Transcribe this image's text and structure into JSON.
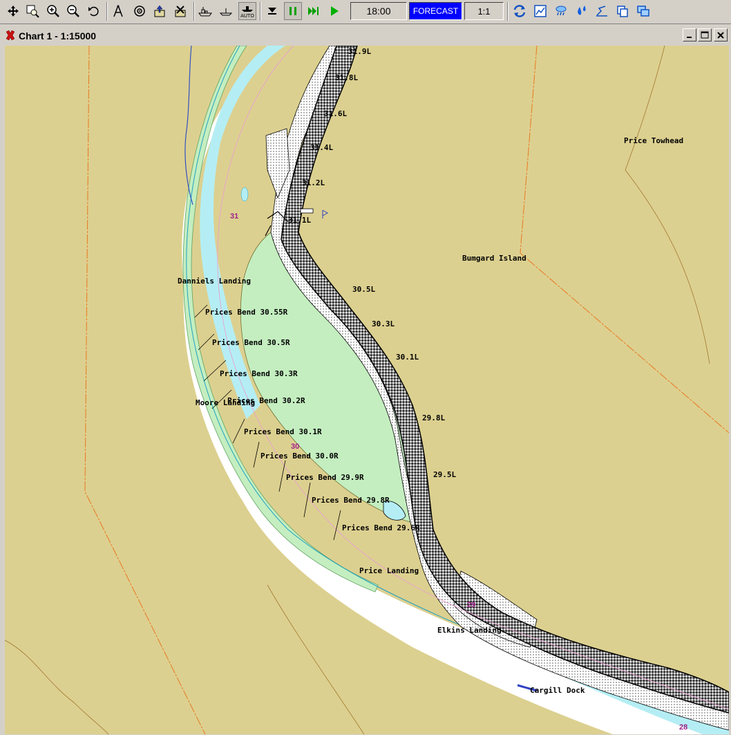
{
  "toolbar": {
    "tools": [
      {
        "name": "pan-icon"
      },
      {
        "name": "zoom-box-icon"
      },
      {
        "name": "zoom-in-icon"
      },
      {
        "name": "zoom-out-icon"
      },
      {
        "name": "undo-view-icon"
      },
      {
        "name": "compass-icon"
      },
      {
        "name": "target-icon"
      },
      {
        "name": "export-icon"
      },
      {
        "name": "delete-icon"
      },
      {
        "name": "vessel-icon"
      },
      {
        "name": "boat-icon"
      },
      {
        "name": "auto-track-icon"
      },
      {
        "name": "stop-icon"
      },
      {
        "name": "pause-icon"
      },
      {
        "name": "fast-forward-icon"
      },
      {
        "name": "play-icon"
      },
      {
        "name": "sync-icon"
      },
      {
        "name": "chart-icon"
      },
      {
        "name": "weather-icon"
      },
      {
        "name": "water-level-icon"
      },
      {
        "name": "route-icon"
      },
      {
        "name": "copy-icon"
      },
      {
        "name": "windows-icon"
      }
    ],
    "auto_label": "AUTO",
    "time": "18:00",
    "forecast_label": "FORECAST",
    "scale_label": "1:1"
  },
  "window": {
    "title": "Chart 1 - 1:15000"
  },
  "map": {
    "mile_labels": [
      {
        "text": "31.9L"
      },
      {
        "text": "31.8L"
      },
      {
        "text": "31.6L"
      },
      {
        "text": "31.4L"
      },
      {
        "text": "31.2L"
      },
      {
        "text": "31.1L"
      },
      {
        "text": "30.5L"
      },
      {
        "text": "30.3L"
      },
      {
        "text": "30.1L"
      },
      {
        "text": "29.8L"
      },
      {
        "text": "29.5L"
      }
    ],
    "bend_labels": [
      {
        "text": "Prices Bend 30.55R"
      },
      {
        "text": "Prices Bend 30.5R"
      },
      {
        "text": "Prices Bend 30.3R"
      },
      {
        "text": "Prices Bend 30.2R"
      },
      {
        "text": "Prices Bend 30.1R"
      },
      {
        "text": "Prices Bend 30.0R"
      },
      {
        "text": "Prices Bend 29.9R"
      },
      {
        "text": "Prices Bend 29.8R"
      },
      {
        "text": "Prices Bend 29.6R"
      }
    ],
    "place_labels": [
      {
        "text": "Price Towhead"
      },
      {
        "text": "Bumgard Island"
      },
      {
        "text": "Danniels Landing"
      },
      {
        "text": "Moore Landing"
      },
      {
        "text": "Price Landing"
      },
      {
        "text": "Elkins Landing"
      },
      {
        "text": "Cargill Dock"
      }
    ],
    "river_miles": [
      {
        "text": "31"
      },
      {
        "text": "30"
      },
      {
        "text": "29"
      },
      {
        "text": "28"
      }
    ],
    "colors": {
      "land": "#dcd090",
      "river": "#ffffff",
      "shallow": "#b4eef4",
      "island": "#c4eec0",
      "bluff": "#505050",
      "boundary": "#e87820",
      "depth_number": "#a0208c"
    }
  }
}
